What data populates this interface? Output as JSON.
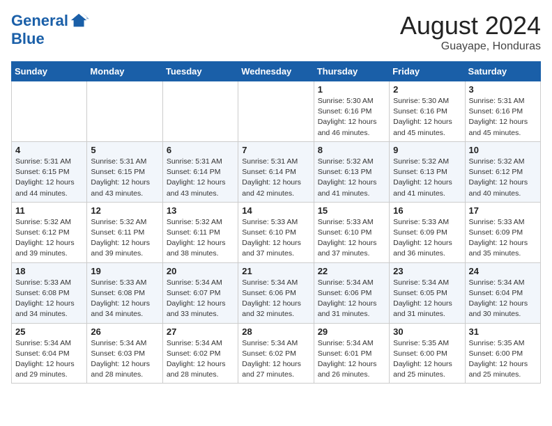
{
  "header": {
    "logo_line1": "General",
    "logo_line2": "Blue",
    "main_title": "August 2024",
    "subtitle": "Guayape, Honduras"
  },
  "weekdays": [
    "Sunday",
    "Monday",
    "Tuesday",
    "Wednesday",
    "Thursday",
    "Friday",
    "Saturday"
  ],
  "weeks": [
    [
      {
        "day": "",
        "info": ""
      },
      {
        "day": "",
        "info": ""
      },
      {
        "day": "",
        "info": ""
      },
      {
        "day": "",
        "info": ""
      },
      {
        "day": "1",
        "info": "Sunrise: 5:30 AM\nSunset: 6:16 PM\nDaylight: 12 hours\nand 46 minutes."
      },
      {
        "day": "2",
        "info": "Sunrise: 5:30 AM\nSunset: 6:16 PM\nDaylight: 12 hours\nand 45 minutes."
      },
      {
        "day": "3",
        "info": "Sunrise: 5:31 AM\nSunset: 6:16 PM\nDaylight: 12 hours\nand 45 minutes."
      }
    ],
    [
      {
        "day": "4",
        "info": "Sunrise: 5:31 AM\nSunset: 6:15 PM\nDaylight: 12 hours\nand 44 minutes."
      },
      {
        "day": "5",
        "info": "Sunrise: 5:31 AM\nSunset: 6:15 PM\nDaylight: 12 hours\nand 43 minutes."
      },
      {
        "day": "6",
        "info": "Sunrise: 5:31 AM\nSunset: 6:14 PM\nDaylight: 12 hours\nand 43 minutes."
      },
      {
        "day": "7",
        "info": "Sunrise: 5:31 AM\nSunset: 6:14 PM\nDaylight: 12 hours\nand 42 minutes."
      },
      {
        "day": "8",
        "info": "Sunrise: 5:32 AM\nSunset: 6:13 PM\nDaylight: 12 hours\nand 41 minutes."
      },
      {
        "day": "9",
        "info": "Sunrise: 5:32 AM\nSunset: 6:13 PM\nDaylight: 12 hours\nand 41 minutes."
      },
      {
        "day": "10",
        "info": "Sunrise: 5:32 AM\nSunset: 6:12 PM\nDaylight: 12 hours\nand 40 minutes."
      }
    ],
    [
      {
        "day": "11",
        "info": "Sunrise: 5:32 AM\nSunset: 6:12 PM\nDaylight: 12 hours\nand 39 minutes."
      },
      {
        "day": "12",
        "info": "Sunrise: 5:32 AM\nSunset: 6:11 PM\nDaylight: 12 hours\nand 39 minutes."
      },
      {
        "day": "13",
        "info": "Sunrise: 5:32 AM\nSunset: 6:11 PM\nDaylight: 12 hours\nand 38 minutes."
      },
      {
        "day": "14",
        "info": "Sunrise: 5:33 AM\nSunset: 6:10 PM\nDaylight: 12 hours\nand 37 minutes."
      },
      {
        "day": "15",
        "info": "Sunrise: 5:33 AM\nSunset: 6:10 PM\nDaylight: 12 hours\nand 37 minutes."
      },
      {
        "day": "16",
        "info": "Sunrise: 5:33 AM\nSunset: 6:09 PM\nDaylight: 12 hours\nand 36 minutes."
      },
      {
        "day": "17",
        "info": "Sunrise: 5:33 AM\nSunset: 6:09 PM\nDaylight: 12 hours\nand 35 minutes."
      }
    ],
    [
      {
        "day": "18",
        "info": "Sunrise: 5:33 AM\nSunset: 6:08 PM\nDaylight: 12 hours\nand 34 minutes."
      },
      {
        "day": "19",
        "info": "Sunrise: 5:33 AM\nSunset: 6:08 PM\nDaylight: 12 hours\nand 34 minutes."
      },
      {
        "day": "20",
        "info": "Sunrise: 5:34 AM\nSunset: 6:07 PM\nDaylight: 12 hours\nand 33 minutes."
      },
      {
        "day": "21",
        "info": "Sunrise: 5:34 AM\nSunset: 6:06 PM\nDaylight: 12 hours\nand 32 minutes."
      },
      {
        "day": "22",
        "info": "Sunrise: 5:34 AM\nSunset: 6:06 PM\nDaylight: 12 hours\nand 31 minutes."
      },
      {
        "day": "23",
        "info": "Sunrise: 5:34 AM\nSunset: 6:05 PM\nDaylight: 12 hours\nand 31 minutes."
      },
      {
        "day": "24",
        "info": "Sunrise: 5:34 AM\nSunset: 6:04 PM\nDaylight: 12 hours\nand 30 minutes."
      }
    ],
    [
      {
        "day": "25",
        "info": "Sunrise: 5:34 AM\nSunset: 6:04 PM\nDaylight: 12 hours\nand 29 minutes."
      },
      {
        "day": "26",
        "info": "Sunrise: 5:34 AM\nSunset: 6:03 PM\nDaylight: 12 hours\nand 28 minutes."
      },
      {
        "day": "27",
        "info": "Sunrise: 5:34 AM\nSunset: 6:02 PM\nDaylight: 12 hours\nand 28 minutes."
      },
      {
        "day": "28",
        "info": "Sunrise: 5:34 AM\nSunset: 6:02 PM\nDaylight: 12 hours\nand 27 minutes."
      },
      {
        "day": "29",
        "info": "Sunrise: 5:34 AM\nSunset: 6:01 PM\nDaylight: 12 hours\nand 26 minutes."
      },
      {
        "day": "30",
        "info": "Sunrise: 5:35 AM\nSunset: 6:00 PM\nDaylight: 12 hours\nand 25 minutes."
      },
      {
        "day": "31",
        "info": "Sunrise: 5:35 AM\nSunset: 6:00 PM\nDaylight: 12 hours\nand 25 minutes."
      }
    ]
  ]
}
